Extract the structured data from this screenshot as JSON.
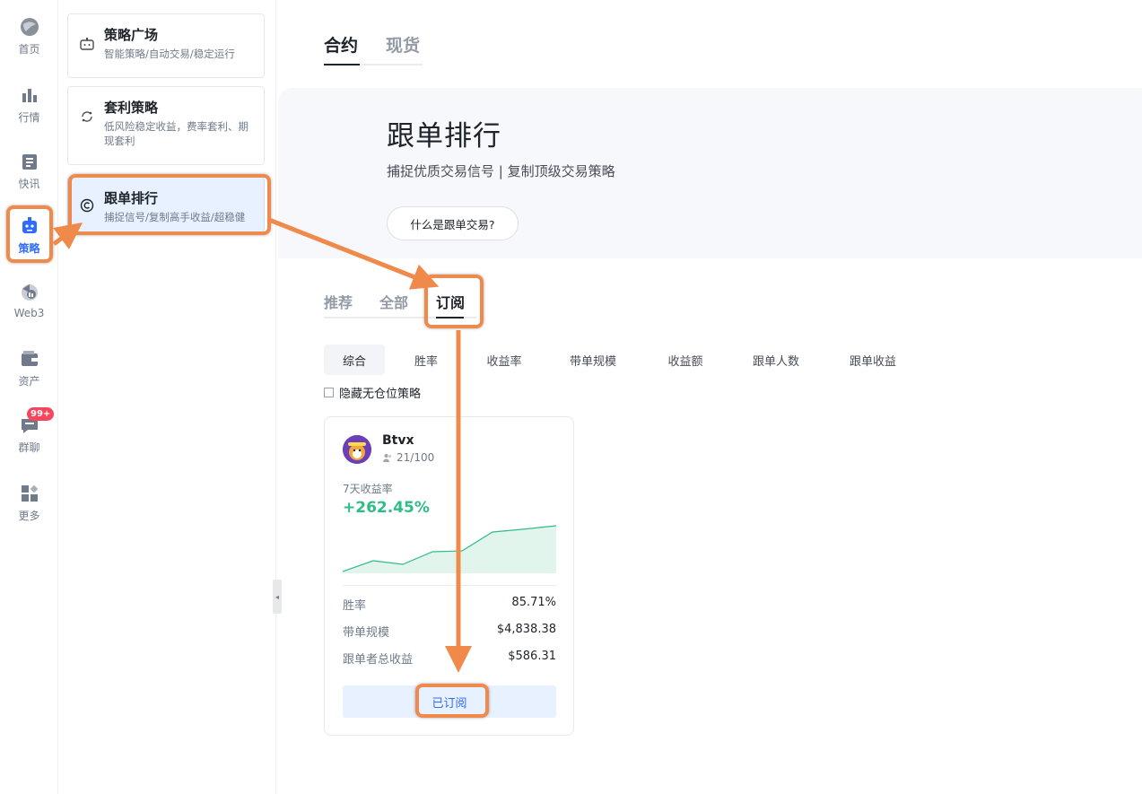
{
  "rail": {
    "items": [
      {
        "label": "首页",
        "icon": "globe-icon"
      },
      {
        "label": "行情",
        "icon": "bar-chart-icon"
      },
      {
        "label": "快讯",
        "icon": "news-icon"
      },
      {
        "label": "策略",
        "icon": "robot-icon"
      },
      {
        "label": "Web3",
        "icon": "web3-icon"
      },
      {
        "label": "资产",
        "icon": "wallet-icon"
      },
      {
        "label": "群聊",
        "icon": "chat-icon",
        "badge": "99+"
      },
      {
        "label": "更多",
        "icon": "grid-icon"
      }
    ]
  },
  "sidebar": {
    "items": [
      {
        "title": "策略广场",
        "desc": "智能策略/自动交易/稳定运行"
      },
      {
        "title": "套利策略",
        "desc": "低风险稳定收益，费率套利、期现套利"
      },
      {
        "title": "跟单排行",
        "desc": "捕捉信号/复制高手收益/超稳健"
      }
    ]
  },
  "main": {
    "top_tabs": [
      "合约",
      "现货"
    ],
    "hero": {
      "title": "跟单排行",
      "subtitle": "捕捉优质交易信号 | 复制顶级交易策略",
      "button": "什么是跟单交易?"
    },
    "tabs": [
      "推荐",
      "全部",
      "订阅"
    ],
    "filters": [
      "综合",
      "胜率",
      "收益率",
      "带单规模",
      "收益额",
      "跟单人数",
      "跟单收益"
    ],
    "hide_checkbox_label": "隐藏无仓位策略",
    "card": {
      "name": "Btvx",
      "followers": "21/100",
      "return_label": "7天收益率",
      "return_value": "+262.45%",
      "win_rate_label": "胜率",
      "win_rate_value": "85.71%",
      "scale_label": "带单规模",
      "scale_value": "$4,838.38",
      "profit_label": "跟单者总收益",
      "profit_value": "$586.31",
      "subscribe_button": "已订阅"
    }
  },
  "colors": {
    "accent": "#2f6bff",
    "positive": "#2ebd85",
    "annotation": "#f08a4b"
  }
}
